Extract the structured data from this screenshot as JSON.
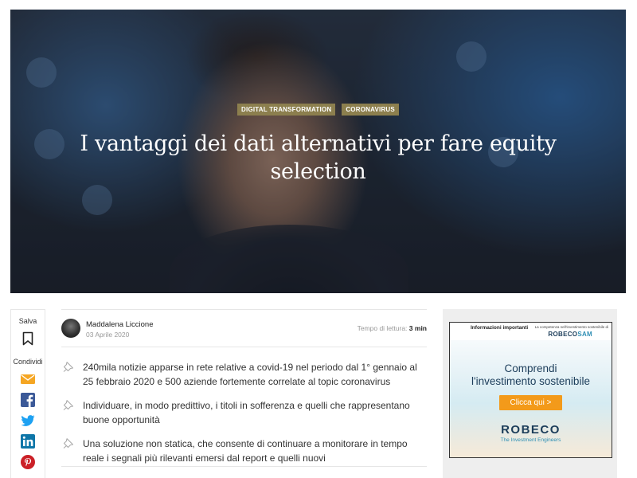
{
  "hero": {
    "tags": [
      "DIGITAL TRANSFORMATION",
      "CORONAVIRUS"
    ],
    "title": "I vantaggi dei dati alternativi per fare equity selection"
  },
  "share": {
    "save_label": "Salva",
    "share_label": "Condividi",
    "icons": [
      "bookmark-icon",
      "email-icon",
      "facebook-icon",
      "twitter-icon",
      "linkedin-icon",
      "pinterest-icon"
    ]
  },
  "article": {
    "author": "Maddalena Liccione",
    "date": "03 Aprile 2020",
    "read_time_label": "Tempo di lettura:",
    "read_time_value": "3 min",
    "bullets": [
      "240mila notizie apparse in rete relative a covid-19 nel periodo dal 1° gennaio al 25 febbraio 2020 e 500 aziende fortemente correlate al topic coronavirus",
      "Individuare, in modo predittivo, i titoli in sofferenza e quelli che rappresentano buone opportunità",
      "Una soluzione non statica, che consente di continuare a monitorare in tempo reale i segnali più rilevanti emersi dal report e quelli nuovi"
    ]
  },
  "ad": {
    "info": "Informazioni importanti",
    "tagline": "La competenza nell'investimento sostenibile di",
    "brand_small_a": "ROBECO",
    "brand_small_b": "SAM",
    "headline_1": "Comprendi",
    "headline_2": "l'investimento sostenibile",
    "cta": "Clicca qui >",
    "logo": "ROBECO",
    "sub": "The Investment Engineers"
  },
  "colors": {
    "tag_bg": "#8c7f4e",
    "email": "#f5a623",
    "facebook": "#3b5998",
    "twitter": "#1da1f2",
    "linkedin": "#0e76a8",
    "pinterest": "#cb2027",
    "ad_cta": "#f39a1a"
  }
}
